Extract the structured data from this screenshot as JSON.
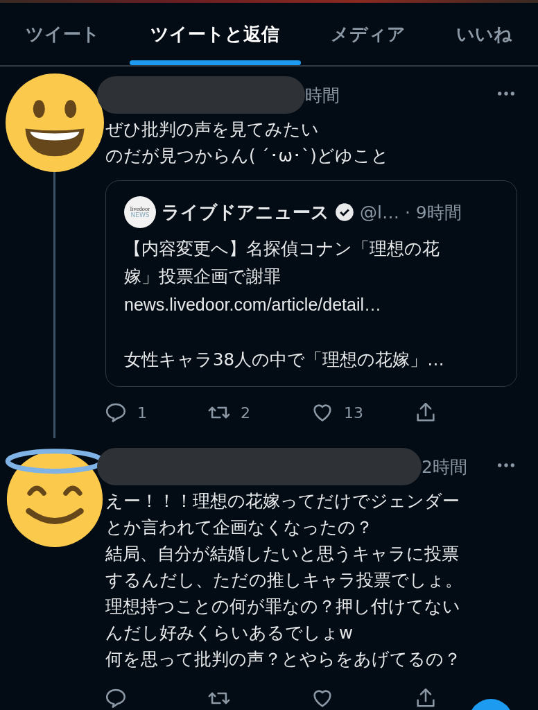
{
  "tabs": [
    {
      "label": "ツイート",
      "selected": false
    },
    {
      "label": "ツイートと返信",
      "selected": true
    },
    {
      "label": "メディア",
      "selected": false
    },
    {
      "label": "いいね",
      "selected": false
    }
  ],
  "tweets": [
    {
      "kind": "smile",
      "time": "時間",
      "lines": [
        "ぜひ批判の声を見てみたい",
        "のだが見つからん( ´･ω･`)どゆこと"
      ],
      "thread": true,
      "quote": {
        "logo_text": "livedoor",
        "logo_subtext": "NEWS",
        "name": "ライブドアニュース",
        "verified": true,
        "handle": "@l…",
        "time": "· 9時間",
        "lines": [
          "【内容変更へ】名探偵コナン「理想の花",
          "嫁」投票企画で謝罪"
        ],
        "link": "news.livedoor.com/article/detail…",
        "text2": "女性キャラ38人の中で「理想の花嫁」…"
      },
      "counts": {
        "reply": "1",
        "retweet": "2",
        "like": "13"
      }
    },
    {
      "kind": "halo",
      "time": "2時間",
      "lines": [
        "えー！！！理想の花嫁ってだけでジェンダー",
        "とか言われて企画なくなったの？",
        "結局、自分が結婚したいと思うキャラに投票",
        "するんだし、ただの推しキャラ投票でしょ。",
        "理想持つことの何が罪なの？押し付けてない",
        "んだし好みくらいあるでしょw",
        "何を思って批判の声？とやらをあげてるの？"
      ],
      "thread": false
    }
  ]
}
